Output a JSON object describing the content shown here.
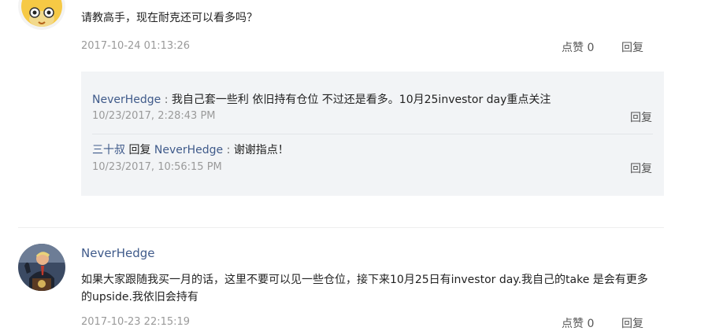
{
  "comment1": {
    "text": "请教高手，现在耐克还可以看多吗？",
    "date": "2017-10-24 01:13:26",
    "like_label": "点赞 0",
    "reply_label": "回复",
    "replies": [
      {
        "user": "NeverHedge",
        "separator": " : ",
        "text": "我自己套一些利 依旧持有仓位 不过还是看多。10月25investor day重点关注",
        "date": "10/23/2017, 2:28:43 PM",
        "reply_label": "回复"
      },
      {
        "user": "三十叔",
        "reply_word": " 回复 ",
        "target_user": "NeverHedge",
        "separator": " : ",
        "text": "谢谢指点！",
        "date": "10/23/2017, 10:56:15 PM",
        "reply_label": "回复"
      }
    ]
  },
  "comment2": {
    "author": "NeverHedge",
    "text": "如果大家跟随我买一月的话，这里不要可以见一些仓位，接下来10月25日有investor day.我自己的take 是会有更多的upside.我依旧会持有",
    "date": "2017-10-23 22:15:19",
    "like_label": "点赞 0",
    "reply_label": "回复"
  },
  "colors": {
    "username": "#3f5a8a",
    "date": "#9a9a9a",
    "reply_box_bg": "#f2f4f6"
  },
  "icons": {
    "avatar1": "yellow-cartoon-avatar",
    "avatar2": "speaker-at-podium-avatar"
  }
}
